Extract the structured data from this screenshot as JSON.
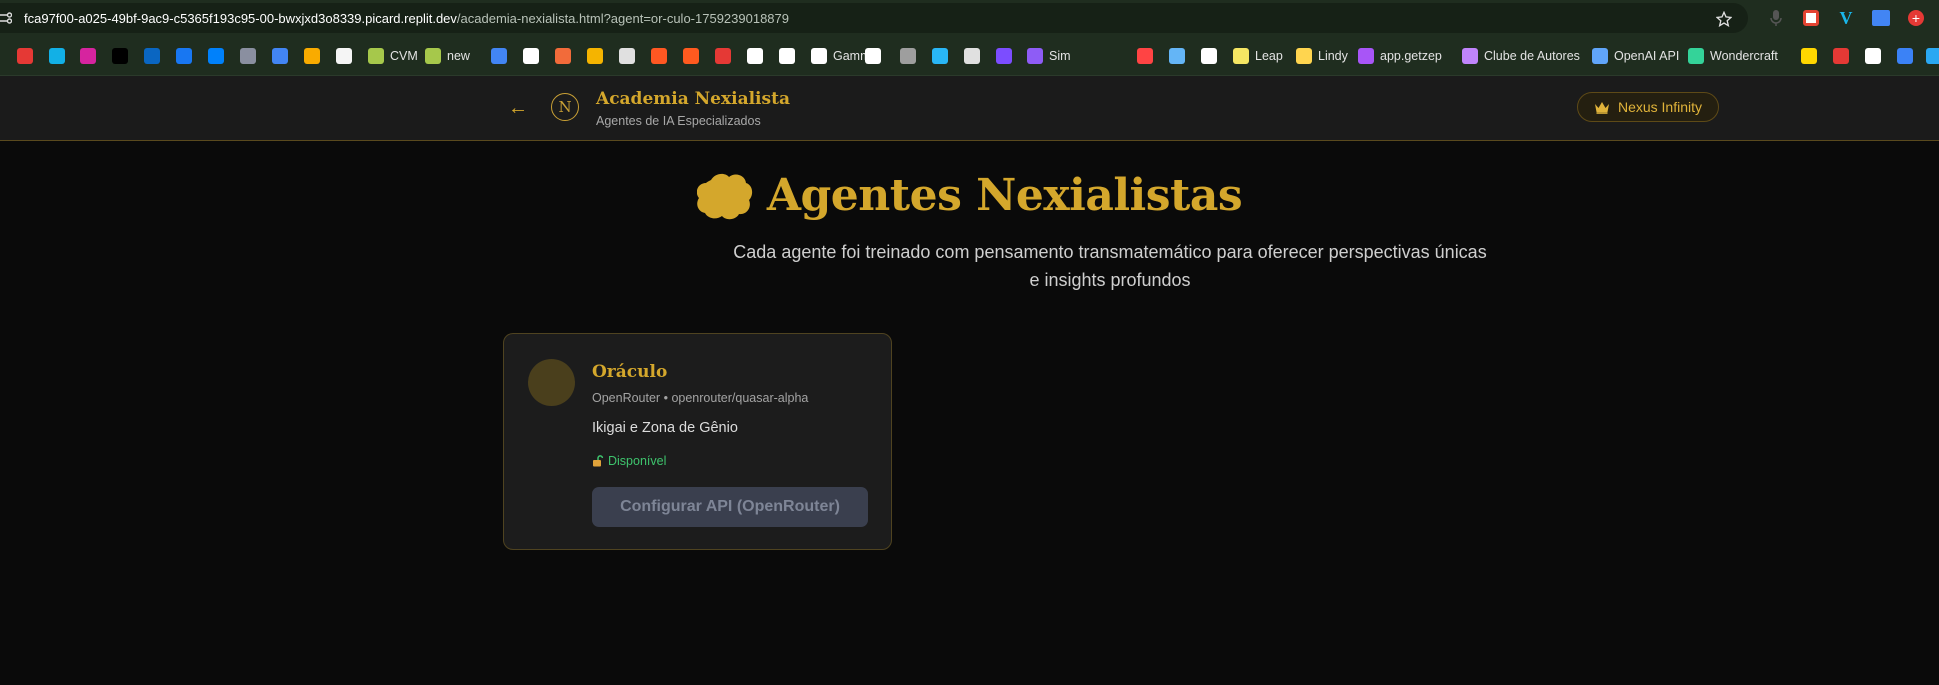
{
  "browser": {
    "url_host": "fca97f00-a025-49bf-9ac9-c5365f193c95-00-bwxjxd3o8339.picard.replit.dev",
    "url_path": "/academia-nexialista.html?agent=or-culo-1759239018879",
    "bookmarks": [
      {
        "label": "",
        "icon": "circle-red-icon",
        "color": "#e53935"
      },
      {
        "label": "",
        "icon": "play-icon",
        "color": "#12b0e6"
      },
      {
        "label": "",
        "icon": "instagram-icon",
        "color": "#d6249f"
      },
      {
        "label": "",
        "icon": "x-icon",
        "color": "#000000"
      },
      {
        "label": "",
        "icon": "linkedin-icon",
        "color": "#0a66c2"
      },
      {
        "label": "",
        "icon": "facebook-icon",
        "color": "#1877f2"
      },
      {
        "label": "",
        "icon": "meta-icon",
        "color": "#0081fb"
      },
      {
        "label": "",
        "icon": "robot-icon",
        "color": "#8a8fa0"
      },
      {
        "label": "",
        "icon": "google-ads-icon",
        "color": "#4285f4"
      },
      {
        "label": "",
        "icon": "analytics-icon",
        "color": "#f9ab00"
      },
      {
        "label": "",
        "icon": "amazon-icon",
        "color": "#f5f5f5"
      },
      {
        "label": "CVM",
        "icon": "cvm-icon",
        "color": "#a6c84b"
      },
      {
        "label": "new",
        "icon": "diamond-icon",
        "color": "#a6c84b"
      },
      {
        "label": "",
        "icon": "docs-icon",
        "color": "#4285f4"
      },
      {
        "label": "",
        "icon": "square-icon",
        "color": "#ffffff"
      },
      {
        "label": "",
        "icon": "flow-icon",
        "color": "#f26b3a"
      },
      {
        "label": "",
        "icon": "triangle-icon",
        "color": "#f5b400"
      },
      {
        "label": "",
        "icon": "face-icon",
        "color": "#e0e0e0"
      },
      {
        "label": "",
        "icon": "circle-orange-icon",
        "color": "#ff5722"
      },
      {
        "label": "",
        "icon": "flame-icon",
        "color": "#ff5a1f"
      },
      {
        "label": "",
        "icon": "cup-icon",
        "color": "#e53935"
      },
      {
        "label": "",
        "icon": "shop-icon",
        "color": "#ffffff"
      },
      {
        "label": "",
        "icon": "openai-icon",
        "color": "#ffffff"
      },
      {
        "label": "Gamma",
        "icon": "google-icon",
        "color": "#ffffff"
      },
      {
        "label": "",
        "icon": "notion-icon",
        "color": "#ffffff"
      },
      {
        "label": "",
        "icon": "share-icon",
        "color": "#9e9e9e"
      },
      {
        "label": "",
        "icon": "c-icon",
        "color": "#29b6f6"
      },
      {
        "label": "",
        "icon": "perplexity-icon",
        "color": "#e0e0e0"
      },
      {
        "label": "",
        "icon": "compass-icon",
        "color": "#7c4dff"
      },
      {
        "label": "Sim",
        "icon": "sim-icon",
        "color": "#8e5cf6"
      },
      {
        "label": "",
        "icon": "youtube-icon",
        "color": "#ff4444"
      },
      {
        "label": "",
        "icon": "settings-icon",
        "color": "#64b5f6"
      },
      {
        "label": "",
        "icon": "miro-icon",
        "color": "#ffffff"
      },
      {
        "label": "Leap",
        "icon": "leap-icon",
        "color": "#f5e663"
      },
      {
        "label": "Lindy",
        "icon": "lindy-icon",
        "color": "#ffd54f"
      },
      {
        "label": "app.getzep",
        "icon": "zep-icon",
        "color": "#a855f7"
      },
      {
        "label": "Clube de Autores",
        "icon": "book-icon",
        "color": "#c084fc"
      },
      {
        "label": "OpenAI API",
        "icon": "openai-api-icon",
        "color": "#60a5fa"
      },
      {
        "label": "Wondercraft",
        "icon": "wave-icon",
        "color": "#34d399"
      },
      {
        "label": "",
        "icon": "miro2-icon",
        "color": "#ffd700"
      },
      {
        "label": "",
        "icon": "dash-icon",
        "color": "#e53935"
      },
      {
        "label": "",
        "icon": "dots-icon",
        "color": "#ffffff"
      },
      {
        "label": "",
        "icon": "spark-icon",
        "color": "#3b82f6"
      },
      {
        "label": "",
        "icon": "bird-icon",
        "color": "#2aa8f2"
      }
    ]
  },
  "header": {
    "title": "Academia Nexialista",
    "subtitle": "Agentes de IA Especializados",
    "logo_letter": "N",
    "badge_label": "Nexus Infinity"
  },
  "hero": {
    "title": "Agentes Nexialistas",
    "subtitle": "Cada agente foi treinado com pensamento transmatemático para oferecer perspectivas únicas e insights profundos"
  },
  "agent": {
    "name": "Oráculo",
    "provider": "OpenRouter",
    "model": "openrouter/quasar-alpha",
    "description": "Ikigai e Zona de Gênio",
    "status": "Disponível",
    "button_label": "Configurar API (OpenRouter)"
  },
  "colors": {
    "gold": "#d4a72c",
    "available_green": "#3ec46d",
    "background": "#0a0a0a"
  }
}
